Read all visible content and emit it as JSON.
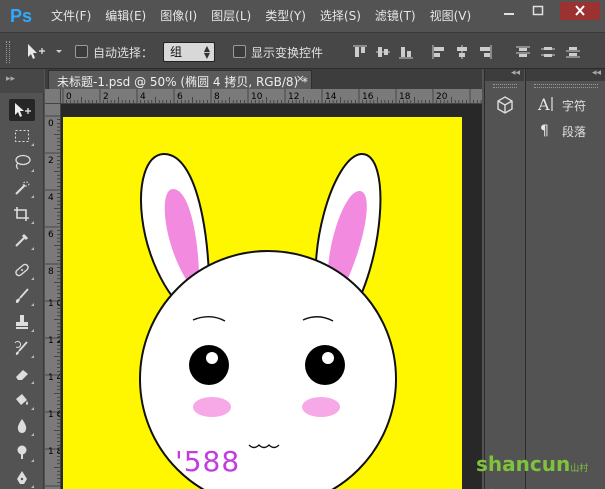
{
  "app": {
    "logo": "Ps"
  },
  "menu": [
    "文件(F)",
    "编辑(E)",
    "图像(I)",
    "图层(L)",
    "类型(Y)",
    "选择(S)",
    "滤镜(T)",
    "视图(V)"
  ],
  "options": {
    "auto_select_label": "自动选择：",
    "auto_select_value": "组",
    "show_transform_label": "显示变换控件"
  },
  "document": {
    "tab_title": "未标题-1.psd @ 50% (椭圆 4 拷贝, RGB/8) *",
    "close_glyph": "×",
    "canvas_color": "#fff700",
    "scribble_text": "'588"
  },
  "ruler": {
    "h_labels": [
      "0",
      "2",
      "4",
      "6",
      "8",
      "10",
      "12",
      "14",
      "16",
      "18",
      "20"
    ],
    "v_labels": [
      "0",
      "2",
      "4",
      "6",
      "8",
      "1\n0",
      "1\n2",
      "1\n4",
      "1\n6",
      "1\n8"
    ]
  },
  "panels": {
    "character_label": "字符",
    "paragraph_label": "段落"
  },
  "watermark": {
    "text": "shancun",
    "small": "山村\n.net"
  },
  "colors": {
    "ps_blue": "#31a8ff",
    "close_red": "#9b3131",
    "ear_pink": "#f28be0",
    "blush": "#f7a8e6"
  }
}
